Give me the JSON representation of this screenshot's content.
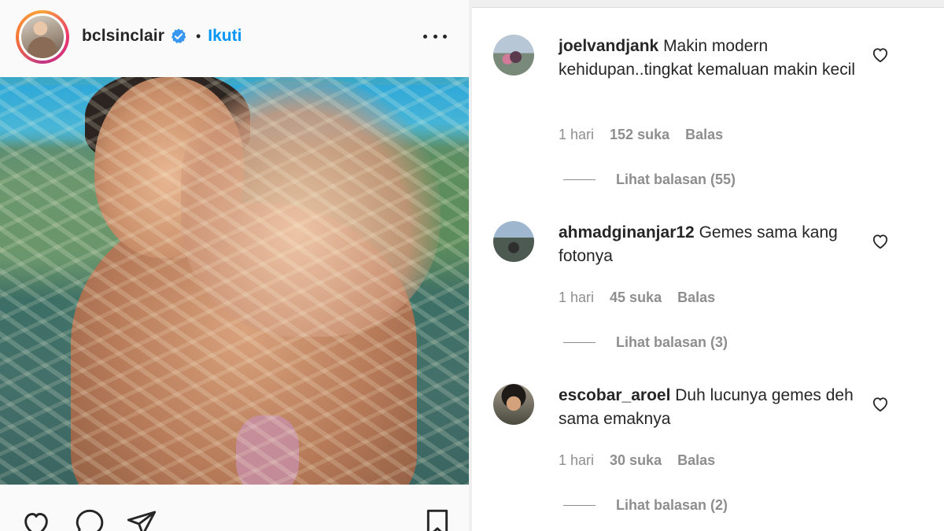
{
  "post": {
    "username": "bclsinclair",
    "separator": "•",
    "follow_label": "Ikuti",
    "image_alt": "",
    "avatar_icon": "profile-avatar"
  },
  "colors": {
    "link_blue": "#0095f6",
    "verified_blue": "#3897f0",
    "meta_gray": "#8e8e8e",
    "text_dark": "#262626"
  },
  "comments": [
    {
      "username": "joelvandjank",
      "text": "Makin modern kehidupan..tingkat kemaluan makin kecil",
      "time": "1 hari",
      "likes": "152 suka",
      "reply_label": "Balas",
      "view_replies": "Lihat balasan (55)"
    },
    {
      "username": "ahmadginanjar12",
      "text": "Gemes sama kang fotonya",
      "time": "1 hari",
      "likes": "45 suka",
      "reply_label": "Balas",
      "view_replies": "Lihat balasan (3)"
    },
    {
      "username": "escobar_aroel",
      "text": "Duh lucunya gemes deh sama emaknya",
      "time": "1 hari",
      "likes": "30 suka",
      "reply_label": "Balas",
      "view_replies": "Lihat balasan (2)"
    }
  ],
  "actions": {
    "like_icon": "heart-icon",
    "comment_icon": "comment-icon",
    "share_icon": "send-icon",
    "save_icon": "bookmark-icon"
  }
}
